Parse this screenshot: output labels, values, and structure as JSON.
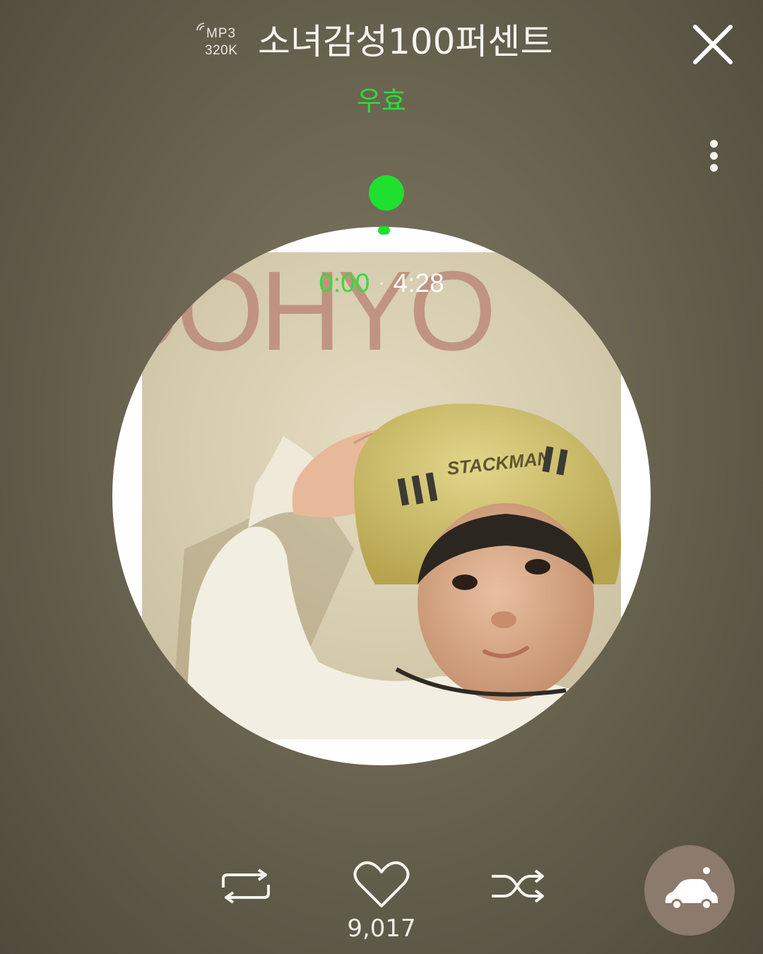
{
  "header": {
    "quality_format": "MP3",
    "quality_bitrate": "320K",
    "song_title": "소녀감성100퍼센트",
    "artist": "우효"
  },
  "player": {
    "progress": 0,
    "current_time": "0:00",
    "separator": "·",
    "total_time": "4:28"
  },
  "controls": {
    "like_count": "9,017"
  },
  "album_art": {
    "cover_text": "OOHYO",
    "helmet_text": "STACKMAN"
  },
  "colors": {
    "accent": "#1fe02f",
    "background": "#6a6451",
    "drive_button": "#8c7a6c"
  },
  "icons": {
    "close": "close-icon",
    "more": "more-vertical-icon",
    "repeat": "repeat-icon",
    "heart": "heart-icon",
    "shuffle": "shuffle-icon",
    "drive": "car-icon"
  }
}
